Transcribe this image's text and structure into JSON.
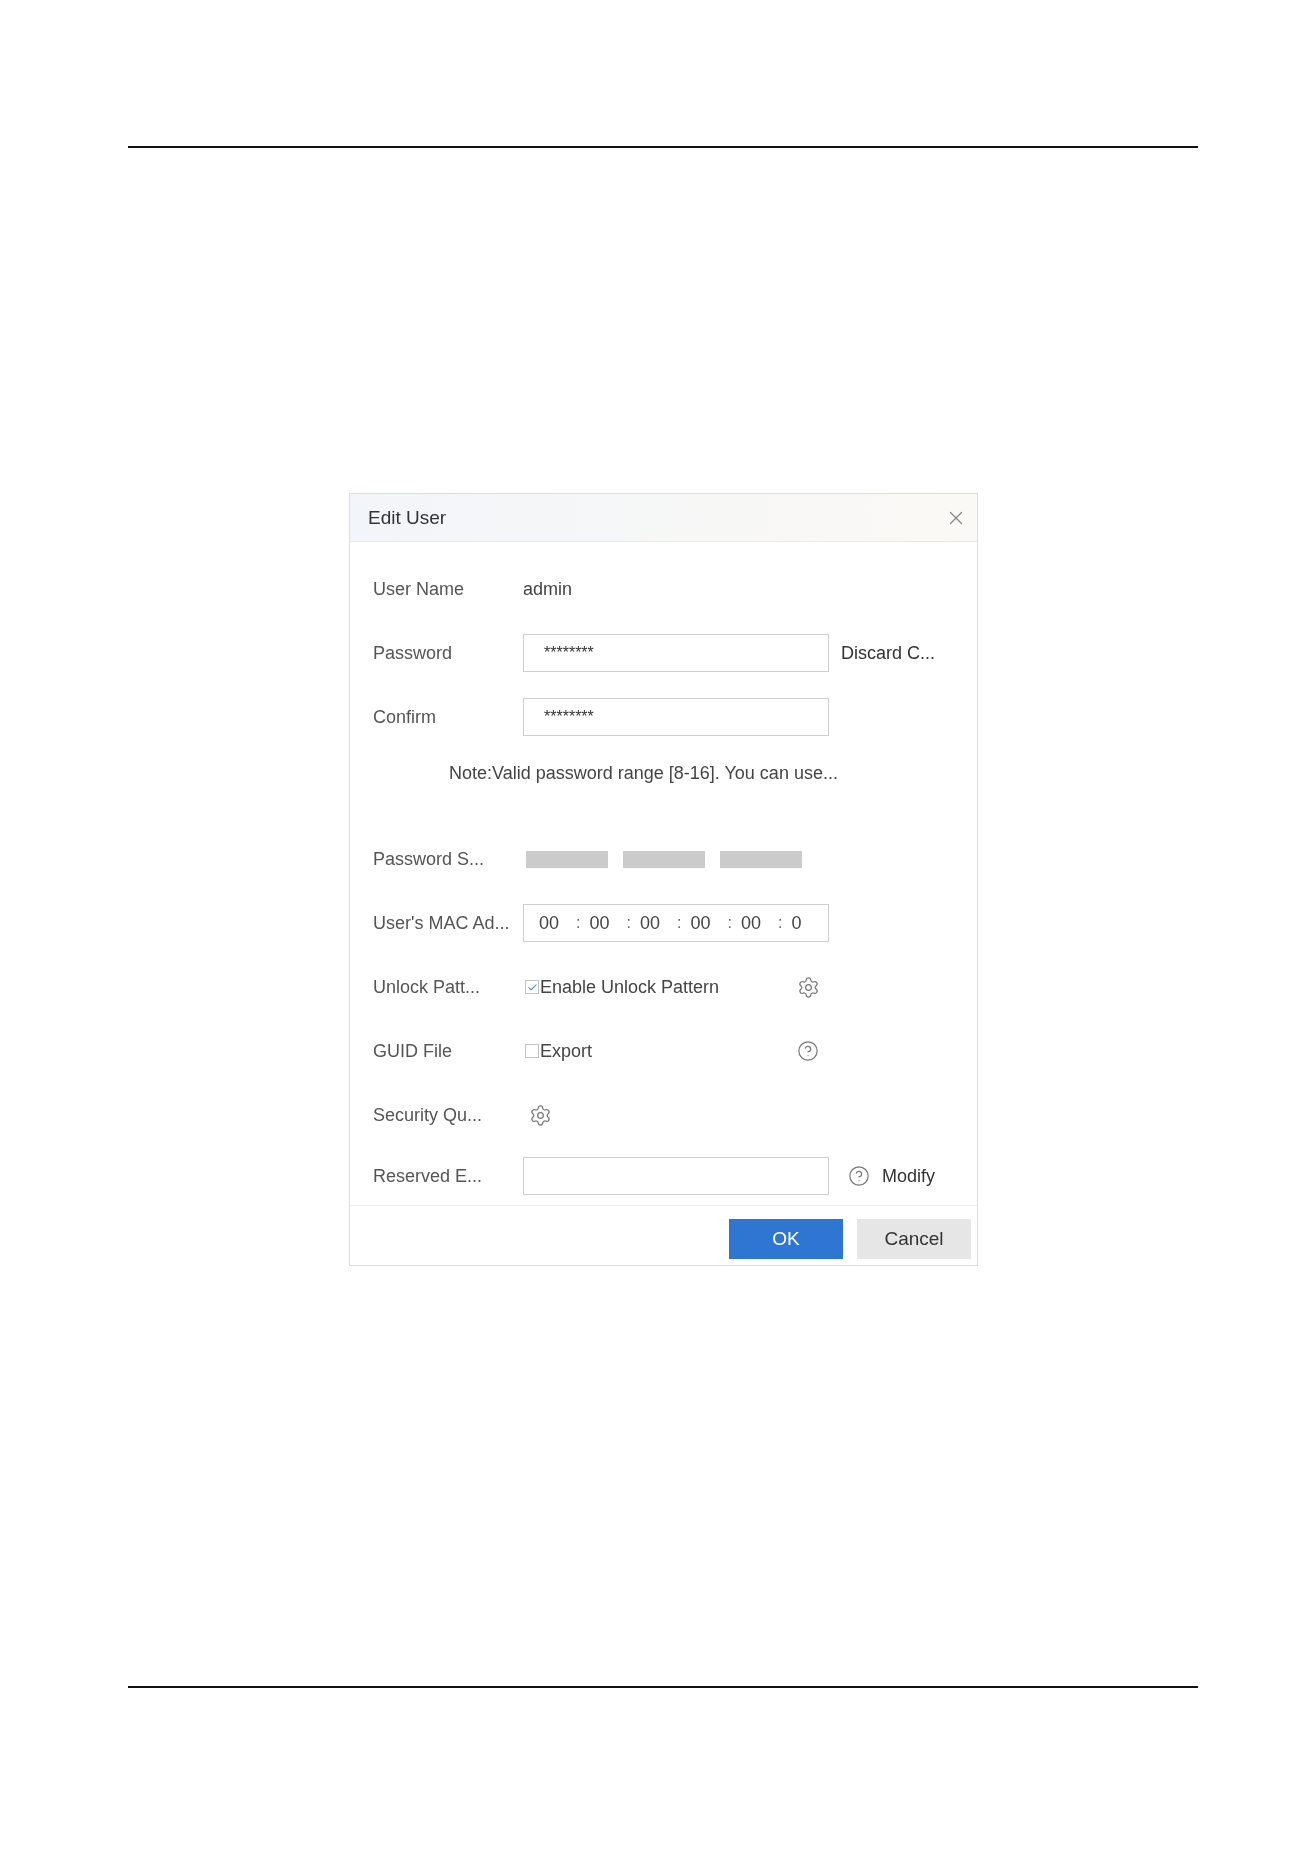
{
  "dialog": {
    "title": "Edit User",
    "fields": [
      {
        "kind": "info",
        "label": "User Name",
        "value": "admin"
      },
      {
        "kind": "password",
        "label": "Password",
        "value": "********",
        "action": "Discard C..."
      },
      {
        "kind": "password",
        "label": "Confirm",
        "value": "********"
      },
      {
        "kind": "note",
        "text": "Note:Valid password range [8-16]. You can use..."
      },
      {
        "kind": "strength",
        "label": "Password S...",
        "segments": [
          {
            "on": false
          },
          {
            "on": false
          },
          {
            "on": false
          }
        ]
      },
      {
        "kind": "mac",
        "label": "User's MAC Ad...",
        "octets": [
          "00",
          "00",
          "00",
          "00",
          "00",
          "0"
        ],
        "separator": ":"
      },
      {
        "kind": "pattern",
        "label": "Unlock Patt...",
        "option": "Enable Unlock Pattern",
        "checked": true
      },
      {
        "kind": "guid",
        "label": "GUID File",
        "option": "Export",
        "checked": false
      },
      {
        "kind": "security",
        "label": "Security Qu..."
      },
      {
        "kind": "email",
        "label": "Reserved E...",
        "link": "Modify"
      }
    ],
    "buttons": [
      {
        "label": "OK",
        "kind": "primary"
      },
      {
        "label": "Cancel",
        "kind": "secondary"
      }
    ]
  }
}
